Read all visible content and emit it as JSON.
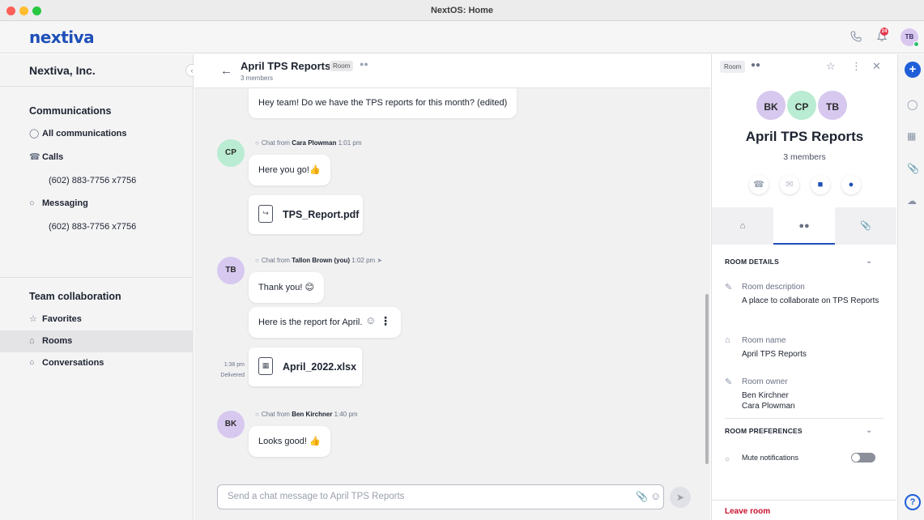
{
  "window": {
    "title": "NextOS: Home"
  },
  "header": {
    "logo": "nextiva",
    "notification_count": "24",
    "user_initials": "TB",
    "icons": [
      "phone-icon",
      "bell-icon"
    ]
  },
  "sidebar": {
    "org_name": "Nextiva, Inc.",
    "communications_heading": "Communications",
    "all_communications": "All communications",
    "calls": "Calls",
    "calls_number": "(602) 883-7756 x7756",
    "messaging": "Messaging",
    "messaging_number": "(602) 883-7756 x7756",
    "team_heading": "Team collaboration",
    "favorites": "Favorites",
    "rooms": "Rooms",
    "conversations": "Conversations"
  },
  "chat": {
    "title": "April TPS Reports",
    "tag": "Room",
    "members": "3 members",
    "messages": {
      "m0_text": "Hey team! Do we have the TPS reports for this month?  (edited)",
      "cp_meta_prefix": "Chat from",
      "cp_name": "Cara Plowman",
      "cp_time": "1:01 pm",
      "cp_initials": "CP",
      "cp_text": "Here you go!",
      "cp_file": "TPS_Report.pdf",
      "tb_meta_prefix": "Chat from",
      "tb_name": "Tallon Brown (you)",
      "tb_time": "1:02 pm",
      "tb_initials": "TB",
      "tb_text1": "Thank you!",
      "tb_text2": "Here is the report for April.",
      "tb_file": "April_2022.xlsx",
      "tb_file_time": "1:38 pm",
      "tb_file_status": "Delivered",
      "bk_meta_prefix": "Chat from",
      "bk_name": "Ben Kirchner",
      "bk_time": "1:40 pm",
      "bk_initials": "BK",
      "bk_text": "Looks good!"
    },
    "composer_placeholder": "Send a chat message to April TPS Reports"
  },
  "details": {
    "tag": "Room",
    "avatars": [
      "BK",
      "CP",
      "TB"
    ],
    "title": "April TPS Reports",
    "members": "3 members",
    "room_details_heading": "ROOM DETAILS",
    "description_label": "Room description",
    "description_value": "A place to collaborate on TPS Reports",
    "room_name_label": "Room name",
    "room_name_value": "April TPS Reports",
    "room_owner_label": "Room owner",
    "room_owner_1": "Ben Kirchner",
    "room_owner_2": "Cara Plowman",
    "preferences_heading": "ROOM PREFERENCES",
    "mute_label": "Mute notifications",
    "leave_label": "Leave room"
  },
  "colors": {
    "brand": "#1e4fb8",
    "accent": "#1e5fd8",
    "danger": "#c8102e",
    "avatar_cp": "#b9ecd2",
    "avatar_purple": "#d7c8ef"
  }
}
